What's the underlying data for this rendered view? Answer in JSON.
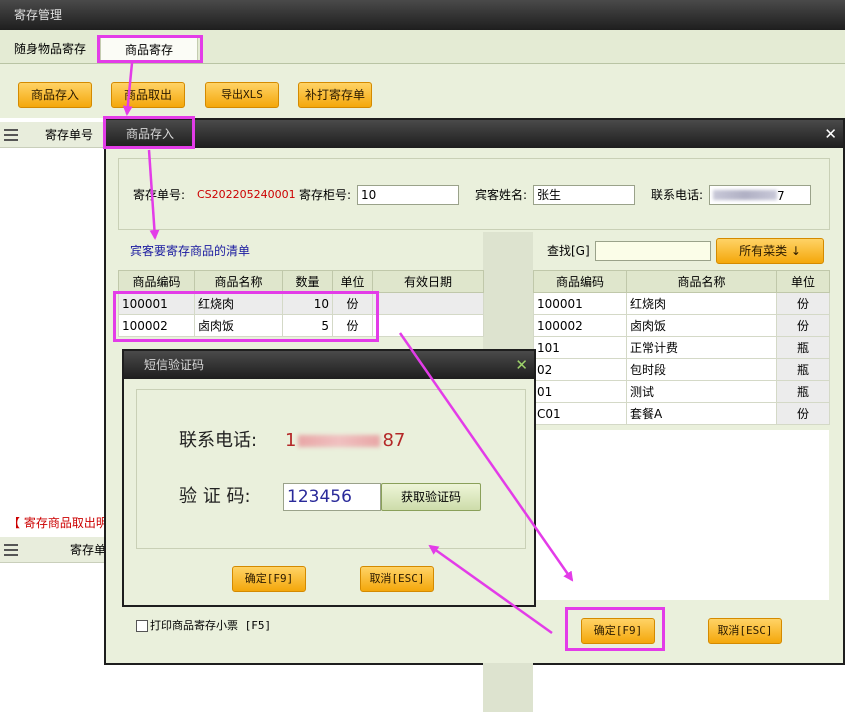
{
  "window": {
    "title": "寄存管理"
  },
  "tabs": [
    {
      "label": "随身物品寄存"
    },
    {
      "label": "商品寄存"
    }
  ],
  "toolbar": {
    "deposit": "商品存入",
    "withdraw": "商品取出",
    "export": "导出XLS",
    "reprint": "补打寄存单"
  },
  "grid": {
    "col_order_no": "寄存单号"
  },
  "section2": {
    "title": "【 寄存商品取出明",
    "col_order_no": "寄存单"
  },
  "dialog_deposit": {
    "title": "商品存入",
    "order_no_label": "寄存单号:",
    "order_no_value": "CS202205240001",
    "locker_label": "寄存柜号:",
    "locker_value": "10",
    "guest_label": "宾客姓名:",
    "guest_value": "张生",
    "phone_label": "联系电话:",
    "phone_value_visible": "7",
    "list_title": "宾客要寄存商品的清单",
    "left_headers": [
      "商品编码",
      "商品名称",
      "数量",
      "单位",
      "有效日期"
    ],
    "left_rows": [
      [
        "100001",
        "红烧肉",
        "10",
        "份",
        ""
      ],
      [
        "100002",
        "卤肉饭",
        "5",
        "份",
        ""
      ]
    ],
    "search_label": "查找[G]",
    "search_value": "",
    "category_button": "所有菜类 ↓",
    "right_headers": [
      "商品编码",
      "商品名称",
      "单位"
    ],
    "right_rows": [
      [
        "100001",
        "红烧肉",
        "份"
      ],
      [
        "100002",
        "卤肉饭",
        "份"
      ],
      [
        "101",
        "正常计费",
        "瓶"
      ],
      [
        "02",
        "包时段",
        "瓶"
      ],
      [
        "01",
        "测试",
        "瓶"
      ],
      [
        "C01",
        "套餐A",
        "份"
      ]
    ],
    "print_label": "打印商品寄存小票 [F5]",
    "print_checked": false,
    "confirm": "确定[F9]",
    "cancel": "取消[ESC]"
  },
  "dialog_sms": {
    "title": "短信验证码",
    "phone_label": "联系电话:",
    "phone_value_visible_start": "1",
    "phone_value_visible_end": "87",
    "code_label": "验 证 码:",
    "code_value": "123456",
    "get_code": "获取验证码",
    "confirm": "确定[F9]",
    "cancel": "取消[ESC]"
  },
  "colors": {
    "highlight": "#e33ce8",
    "orange_button": "#f4a70b",
    "panel": "#eaf0dc",
    "red_text": "#cc0000"
  }
}
